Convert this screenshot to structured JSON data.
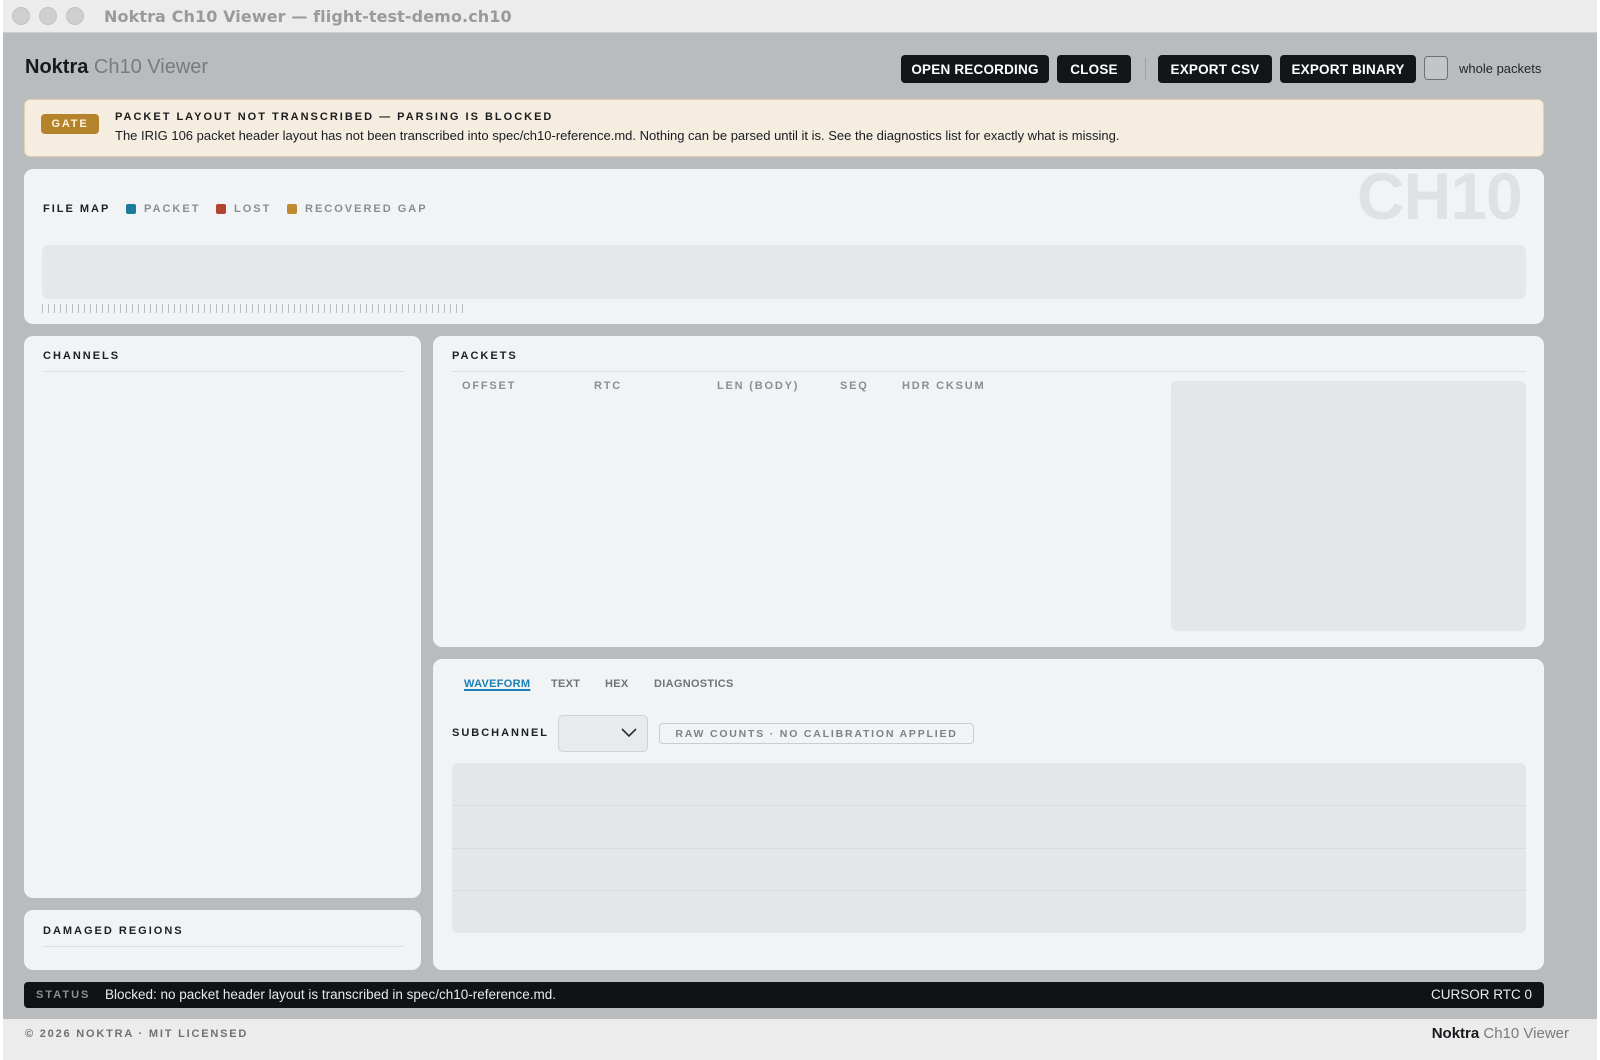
{
  "window": {
    "title": "Noktra Ch10 Viewer — flight-test-demo.ch10"
  },
  "header": {
    "brand_name": "Noktra",
    "brand_product": "Ch10 Viewer",
    "buttons": {
      "open": "OPEN RECORDING",
      "close": "CLOSE",
      "export_csv": "EXPORT CSV",
      "export_binary": "EXPORT BINARY"
    },
    "whole_packets_label": "whole packets",
    "whole_packets_checked": false
  },
  "gate": {
    "badge": "GATE",
    "title": "PACKET LAYOUT NOT TRANSCRIBED — PARSING IS BLOCKED",
    "message": "The IRIG 106 packet header layout has not been transcribed into spec/ch10-reference.md. Nothing can be parsed until it is. See the diagnostics list for exactly what is missing.",
    "accent_color": "#b6832d"
  },
  "file_map": {
    "label": "FILE MAP",
    "watermark": "CH10",
    "legend": [
      {
        "label": "PACKET",
        "color": "#1b7c9a"
      },
      {
        "label": "LOST",
        "color": "#b2432e"
      },
      {
        "label": "RECOVERED GAP",
        "color": "#c08a2f"
      }
    ]
  },
  "channels": {
    "label": "CHANNELS",
    "items": []
  },
  "damaged_regions": {
    "label": "DAMAGED REGIONS",
    "items": []
  },
  "packets": {
    "label": "PACKETS",
    "columns": [
      "OFFSET",
      "RTC",
      "LEN (BODY)",
      "SEQ",
      "HDR CKSUM"
    ],
    "rows": []
  },
  "detail": {
    "tabs": [
      {
        "label": "WAVEFORM",
        "active": true
      },
      {
        "label": "TEXT",
        "active": false
      },
      {
        "label": "HEX",
        "active": false
      },
      {
        "label": "DIAGNOSTICS",
        "active": false
      }
    ],
    "subchannel_label": "SUBCHANNEL",
    "subchannel_value": "",
    "calibration_note": "RAW COUNTS · NO CALIBRATION APPLIED"
  },
  "status": {
    "label": "STATUS",
    "message": "Blocked: no packet header layout is transcribed in spec/ch10-reference.md.",
    "cursor": "CURSOR RTC 0"
  },
  "footer": {
    "copyright": "© 2026 NOKTRA · MIT LICENSED",
    "brand_name": "Noktra",
    "brand_product": "Ch10 Viewer"
  }
}
